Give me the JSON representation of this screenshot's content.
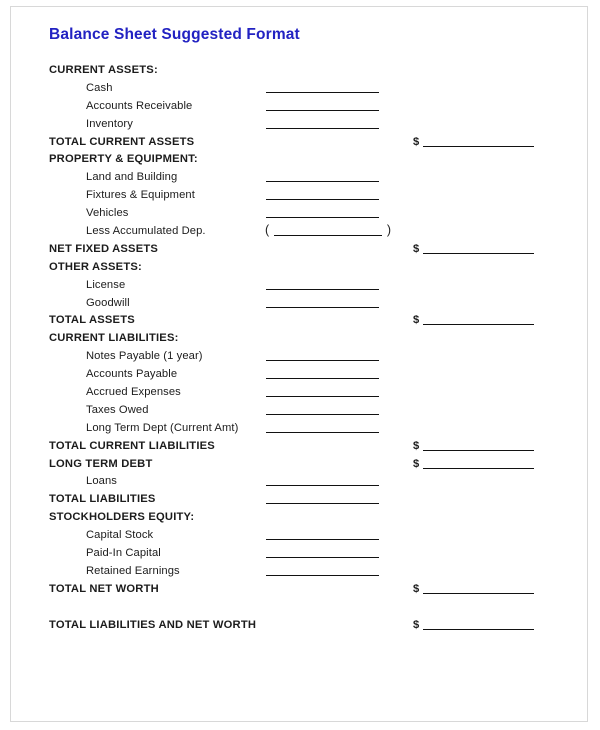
{
  "document": {
    "title": "Balance Sheet Suggested Format",
    "title_color": "#2222c2",
    "currency_symbol": "$"
  },
  "rows": [
    {
      "label": "CURRENT ASSETS:",
      "style": "head",
      "blank": "none"
    },
    {
      "label": "Cash",
      "style": "item",
      "blank": "inner"
    },
    {
      "label": "Accounts Receivable",
      "style": "item",
      "blank": "inner"
    },
    {
      "label": "Inventory",
      "style": "item",
      "blank": "inner"
    },
    {
      "label": "TOTAL CURRENT ASSETS",
      "style": "head",
      "blank": "outer"
    },
    {
      "label": "PROPERTY & EQUIPMENT:",
      "style": "head",
      "blank": "none"
    },
    {
      "label": "Land and Building",
      "style": "item",
      "blank": "inner"
    },
    {
      "label": "Fixtures & Equipment",
      "style": "item",
      "blank": "inner"
    },
    {
      "label": "Vehicles",
      "style": "item",
      "blank": "inner"
    },
    {
      "label": "Less Accumulated Dep.",
      "style": "item",
      "blank": "paren"
    },
    {
      "label": "NET FIXED ASSETS",
      "style": "head",
      "blank": "outer"
    },
    {
      "label": "OTHER ASSETS:",
      "style": "head",
      "blank": "none"
    },
    {
      "label": "License",
      "style": "item",
      "blank": "inner"
    },
    {
      "label": "Goodwill",
      "style": "item",
      "blank": "inner"
    },
    {
      "label": "TOTAL ASSETS",
      "style": "head",
      "blank": "outer"
    },
    {
      "label": "CURRENT LIABILITIES:",
      "style": "head",
      "blank": "none"
    },
    {
      "label": "Notes Payable (1 year)",
      "style": "item",
      "blank": "inner"
    },
    {
      "label": "Accounts Payable",
      "style": "item",
      "blank": "inner"
    },
    {
      "label": "Accrued Expenses",
      "style": "item",
      "blank": "inner"
    },
    {
      "label": "Taxes Owed",
      "style": "item",
      "blank": "inner"
    },
    {
      "label": "Long Term Dept (Current Amt)",
      "style": "item",
      "blank": "inner"
    },
    {
      "label": "TOTAL CURRENT LIABILITIES",
      "style": "head",
      "blank": "outer"
    },
    {
      "label": "LONG TERM DEBT",
      "style": "head",
      "blank": "outer"
    },
    {
      "label": "Loans",
      "style": "item",
      "blank": "inner"
    },
    {
      "label": "TOTAL LIABILITIES",
      "style": "head",
      "blank": "inner"
    },
    {
      "label": "STOCKHOLDERS EQUITY:",
      "style": "head",
      "blank": "none"
    },
    {
      "label": "Capital Stock",
      "style": "item",
      "blank": "inner"
    },
    {
      "label": "Paid-In Capital",
      "style": "item",
      "blank": "inner"
    },
    {
      "label": "Retained Earnings",
      "style": "item",
      "blank": "inner"
    },
    {
      "label": "TOTAL NET WORTH",
      "style": "head",
      "blank": "outer"
    },
    {
      "label": "",
      "style": "spacer",
      "blank": "none"
    },
    {
      "label": "TOTAL LIABILITIES AND NET WORTH",
      "style": "head",
      "blank": "outer"
    }
  ]
}
